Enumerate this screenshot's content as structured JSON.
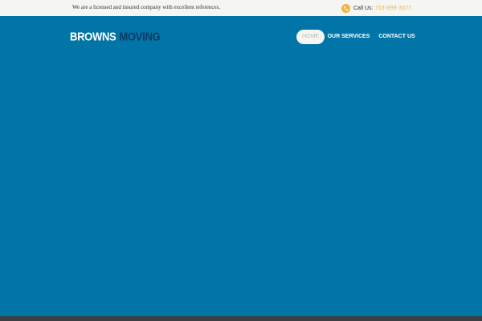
{
  "topbar": {
    "tagline": "We are a licensed and insured company with excellent references.",
    "call_label": "Call Us:",
    "phone": "703-899-3577",
    "phone_icon": "phone-icon"
  },
  "logo": {
    "part1": "BROWNS",
    "part2": "MOVING"
  },
  "nav": {
    "items": [
      {
        "label": "HOME",
        "active": true
      },
      {
        "label": "OUR SERVICES",
        "active": false
      },
      {
        "label": "CONTACT US",
        "active": false
      }
    ]
  },
  "colors": {
    "hero_background": "#0275a8",
    "topbar_background": "#f5f5f3",
    "accent": "#f0b441",
    "logo_dark": "#0b3a63",
    "footer_strip": "#3b3f44"
  }
}
